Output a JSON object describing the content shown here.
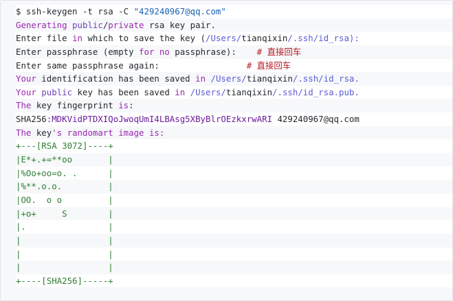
{
  "theme": {
    "background": "#f6f8fa",
    "stripe": "#ffffff",
    "text": "#24292e",
    "keyword": "#9c27b0",
    "string": "#1a5fb4",
    "comment": "#b31d28",
    "art": "#2e7d32"
  },
  "code_block": {
    "lines": [
      {
        "striped": true,
        "tokens": [
          [
            "$ ssh-keygen -t rsa -C ",
            "default"
          ],
          [
            "\"429240967@qq.com\"",
            "string"
          ]
        ]
      },
      {
        "striped": false,
        "tokens": [
          [
            "Generating ",
            "keyword"
          ],
          [
            "public",
            "builtin"
          ],
          [
            "/",
            "default"
          ],
          [
            "private",
            "keyword"
          ],
          [
            " rsa key pair.",
            "default"
          ]
        ]
      },
      {
        "striped": true,
        "tokens": [
          [
            "Enter file ",
            "default"
          ],
          [
            "in",
            "keyword"
          ],
          [
            " which to save the key (",
            "default"
          ],
          [
            "/Users/",
            "path"
          ],
          [
            "tianqixin",
            "default"
          ],
          [
            "/.ssh/id_rsa):",
            "path"
          ]
        ]
      },
      {
        "striped": false,
        "tokens": [
          [
            "Enter passphrase (empty ",
            "default"
          ],
          [
            "for",
            "keyword"
          ],
          [
            " ",
            "default"
          ],
          [
            "no",
            "keyword"
          ],
          [
            " passphrase):    ",
            "default"
          ],
          [
            "# 直接回车",
            "comment"
          ]
        ]
      },
      {
        "striped": true,
        "tokens": [
          [
            "Enter same passphrase again:                 ",
            "default"
          ],
          [
            "# 直接回车",
            "comment"
          ]
        ]
      },
      {
        "striped": false,
        "tokens": [
          [
            "Your",
            "keyword"
          ],
          [
            " identification has been saved ",
            "default"
          ],
          [
            "in",
            "keyword"
          ],
          [
            " ",
            "default"
          ],
          [
            "/Users/",
            "path"
          ],
          [
            "tianqixin",
            "default"
          ],
          [
            "/.ssh/id_rsa.",
            "path"
          ]
        ]
      },
      {
        "striped": true,
        "tokens": [
          [
            "Your",
            "keyword"
          ],
          [
            " ",
            "default"
          ],
          [
            "public",
            "builtin"
          ],
          [
            " key has been saved ",
            "default"
          ],
          [
            "in",
            "keyword"
          ],
          [
            " ",
            "default"
          ],
          [
            "/Users/",
            "path"
          ],
          [
            "tianqixin",
            "default"
          ],
          [
            "/.ssh/id_rsa.pub.",
            "path"
          ]
        ]
      },
      {
        "striped": false,
        "tokens": [
          [
            "The",
            "keyword"
          ],
          [
            " key fingerprint ",
            "default"
          ],
          [
            "is",
            "keyword"
          ],
          [
            ":",
            "default"
          ]
        ]
      },
      {
        "striped": true,
        "tokens": [
          [
            "SHA256",
            "default"
          ],
          [
            ":MDKVidPTDXIQoJwoqUmI4LBAsg5XByBlrOEzkxrwARI",
            "fp"
          ],
          [
            " 429240967@qq.com",
            "default"
          ]
        ]
      },
      {
        "striped": false,
        "tokens": [
          [
            "The",
            "keyword"
          ],
          [
            " key",
            "default"
          ],
          [
            "'s randomart image is:",
            "keyword"
          ]
        ]
      },
      {
        "striped": true,
        "tokens": [
          [
            "+---[RSA 3072]----+",
            "art"
          ]
        ]
      },
      {
        "striped": false,
        "tokens": [
          [
            "|E*+.+=**oo       |",
            "art"
          ]
        ]
      },
      {
        "striped": true,
        "tokens": [
          [
            "|%Oo+oo=o. .      |",
            "art"
          ]
        ]
      },
      {
        "striped": false,
        "tokens": [
          [
            "|%**.o.o.         |",
            "art"
          ]
        ]
      },
      {
        "striped": true,
        "tokens": [
          [
            "|OO.  o o         |",
            "art"
          ]
        ]
      },
      {
        "striped": false,
        "tokens": [
          [
            "|+o+     S        |",
            "art"
          ]
        ]
      },
      {
        "striped": true,
        "tokens": [
          [
            "|.                |",
            "art"
          ]
        ]
      },
      {
        "striped": false,
        "tokens": [
          [
            "|                 |",
            "art"
          ]
        ]
      },
      {
        "striped": true,
        "tokens": [
          [
            "|                 |",
            "art"
          ]
        ]
      },
      {
        "striped": false,
        "tokens": [
          [
            "|                 |",
            "art"
          ]
        ]
      },
      {
        "striped": true,
        "tokens": [
          [
            "+----[SHA256]-----+",
            "art"
          ]
        ]
      }
    ]
  }
}
